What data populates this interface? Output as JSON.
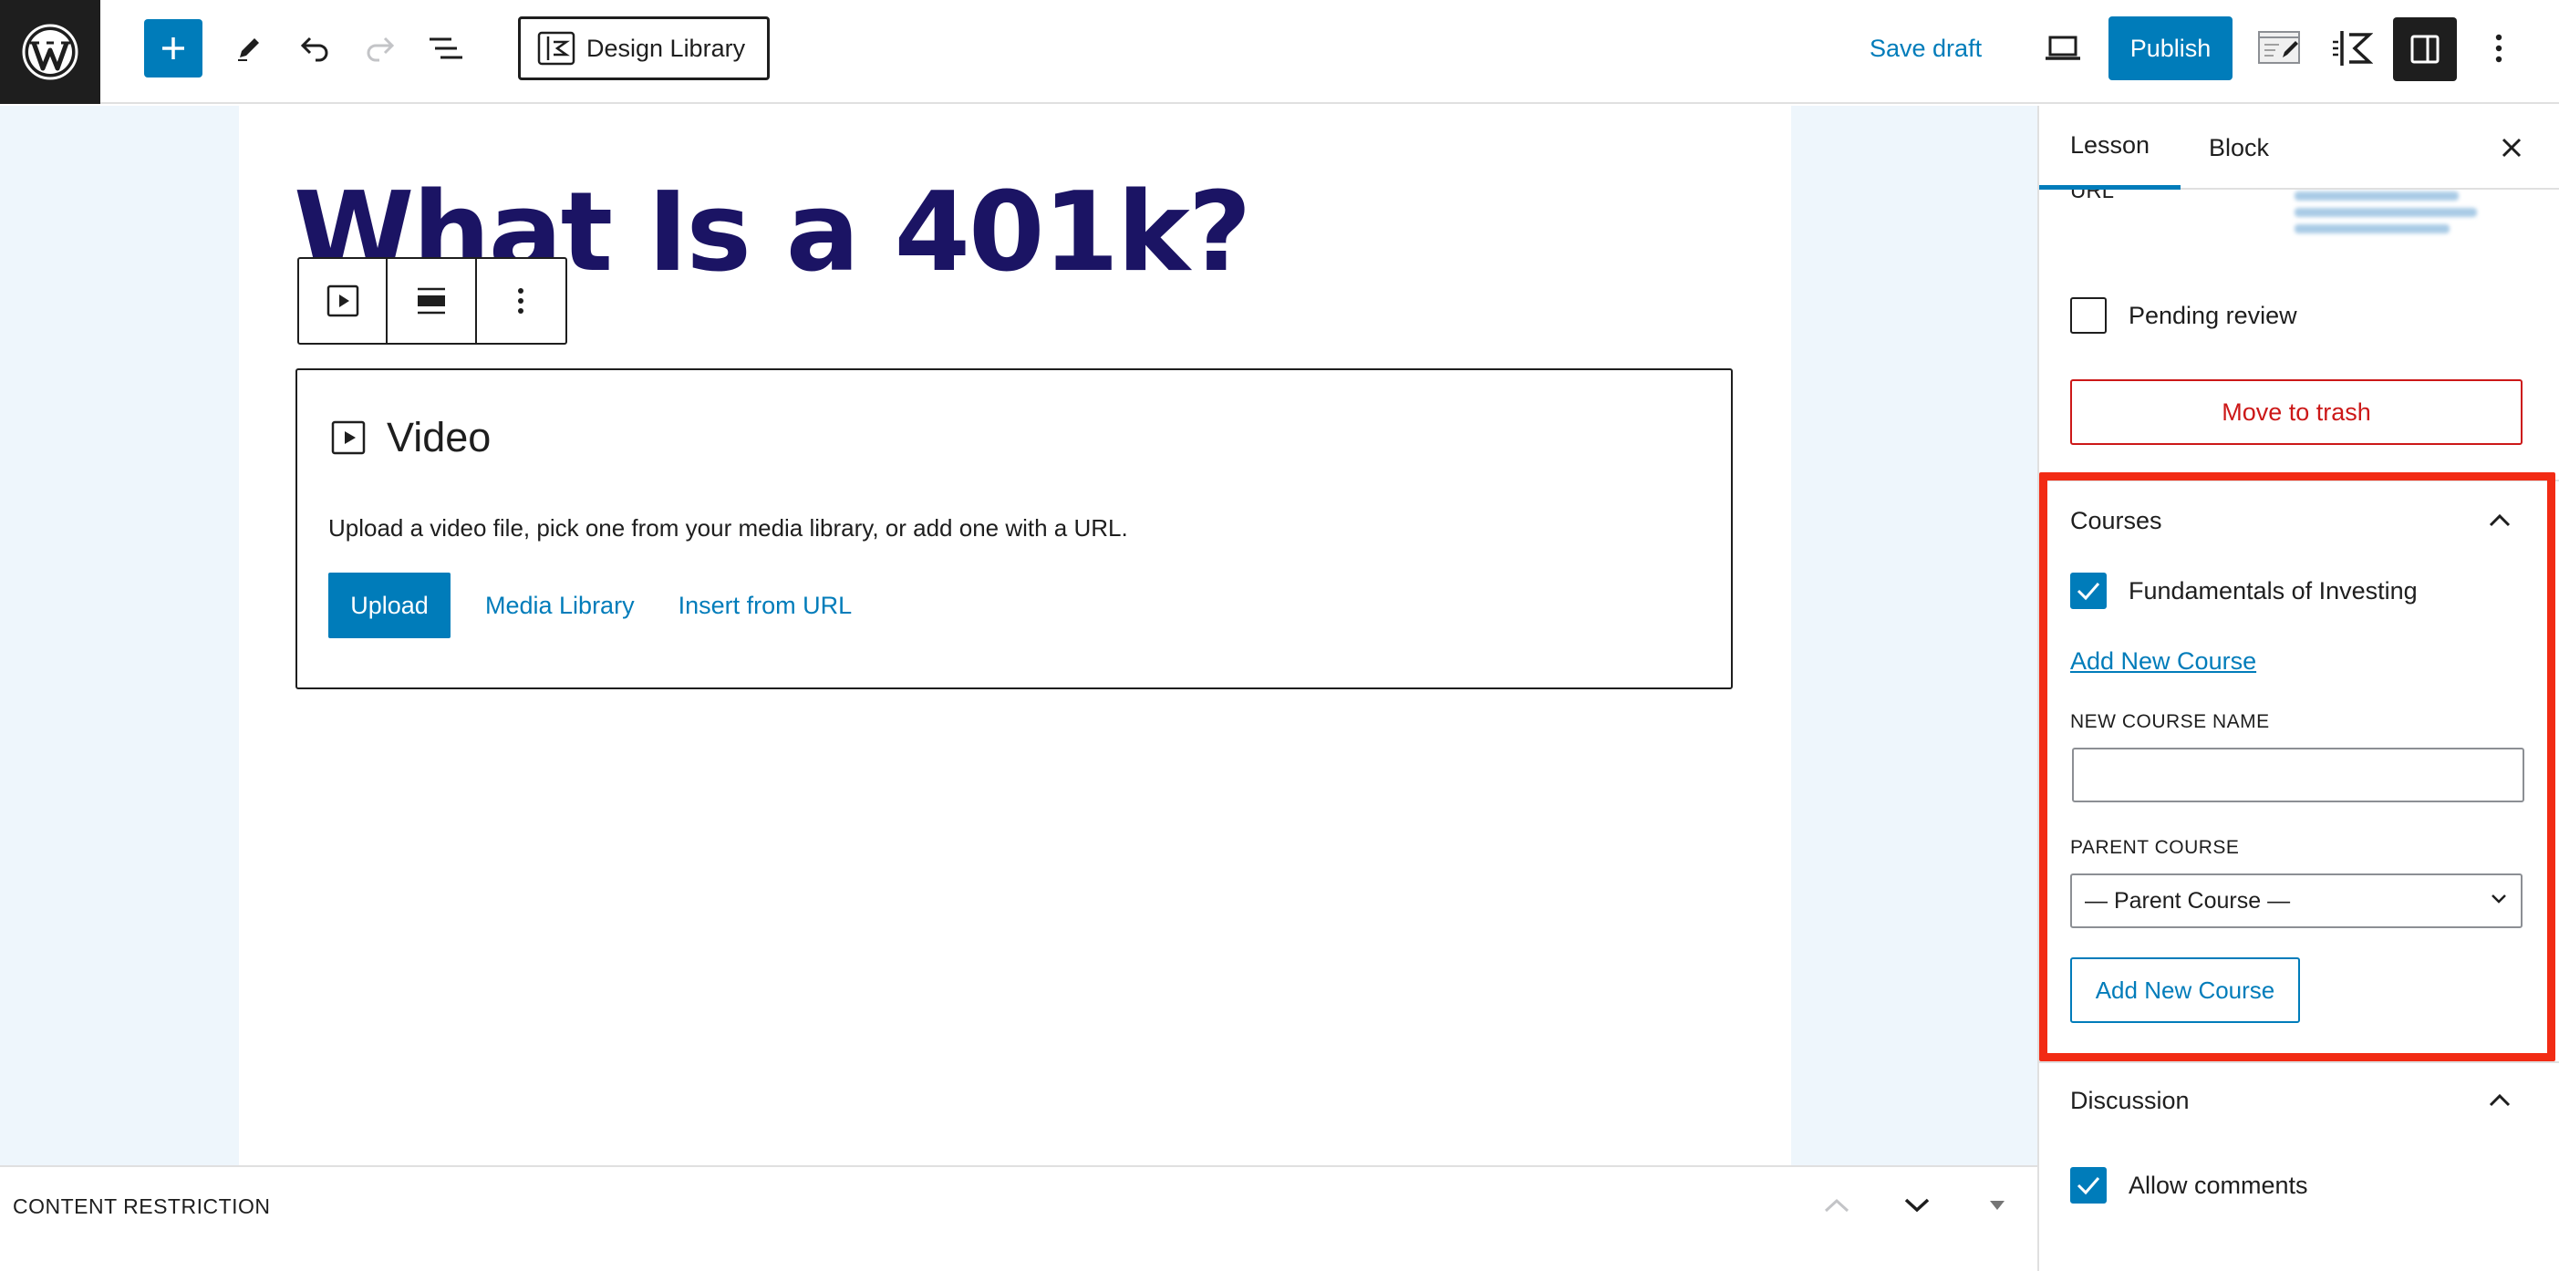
{
  "toolbar": {
    "design_library_label": "Design Library",
    "save_draft_label": "Save draft",
    "publish_label": "Publish"
  },
  "editor": {
    "title": "What Is a 401k?",
    "video_block": {
      "heading": "Video",
      "instructions": "Upload a video file, pick one from your media library, or add one with a URL.",
      "upload_label": "Upload",
      "media_library_label": "Media Library",
      "insert_url_label": "Insert from URL"
    }
  },
  "bottom_bar": {
    "label": "CONTENT RESTRICTION"
  },
  "sidebar": {
    "tabs": [
      "Lesson",
      "Block"
    ],
    "url_label": "URL",
    "pending_review_label": "Pending review",
    "pending_review_checked": false,
    "move_to_trash_label": "Move to trash",
    "courses": {
      "title": "Courses",
      "course_name": "Fundamentals of Investing",
      "course_checked": true,
      "add_new_link": "Add New Course",
      "new_course_name_label": "NEW COURSE NAME",
      "new_course_name_value": "",
      "parent_course_label": "PARENT COURSE",
      "parent_course_selected": "— Parent Course —",
      "add_new_button": "Add New Course"
    },
    "discussion": {
      "title": "Discussion",
      "allow_comments_label": "Allow comments",
      "allow_comments_checked": true
    }
  },
  "colors": {
    "accent": "#007cba",
    "title": "#1b1464",
    "danger": "#cc1818",
    "highlight": "#f22b14"
  }
}
